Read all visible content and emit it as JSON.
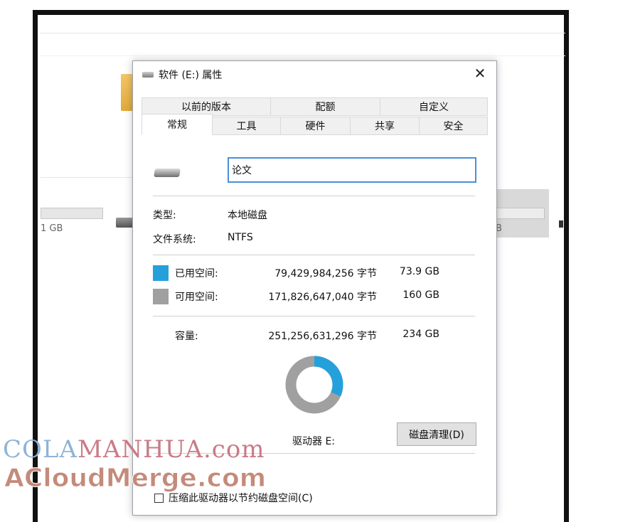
{
  "background": {
    "drive_left_size": "1 GB",
    "drive_right_size": "B"
  },
  "dialog": {
    "title": "软件 (E:) 属性",
    "close_label": "✕",
    "tabs_row1": [
      "以前的版本",
      "配额",
      "自定义"
    ],
    "tabs_row2": [
      "常规",
      "工具",
      "硬件",
      "共享",
      "安全"
    ],
    "active_tab": "常规",
    "drive_name": "论文",
    "type_label": "类型:",
    "type_value": "本地磁盘",
    "fs_label": "文件系统:",
    "fs_value": "NTFS",
    "used": {
      "label": "已用空间:",
      "bytes": "79,429,984,256 字节",
      "size": "73.9 GB",
      "color": "#26a0da"
    },
    "free": {
      "label": "可用空间:",
      "bytes": "171,826,647,040 字节",
      "size": "160 GB",
      "color": "#a0a0a0"
    },
    "capacity": {
      "label": "容量:",
      "bytes": "251,256,631,296 字节",
      "size": "234 GB"
    },
    "drive_letter": "驱动器 E:",
    "cleanup_button": "磁盘清理(D)",
    "compress_label": "压缩此驱动器以节约磁盘空间(C)",
    "used_fraction": 0.316
  },
  "watermark": {
    "line1_a": "COLA",
    "line1_b": "MANHUA",
    "line1_c": ".com",
    "line2": "ACloudMerge.com"
  }
}
